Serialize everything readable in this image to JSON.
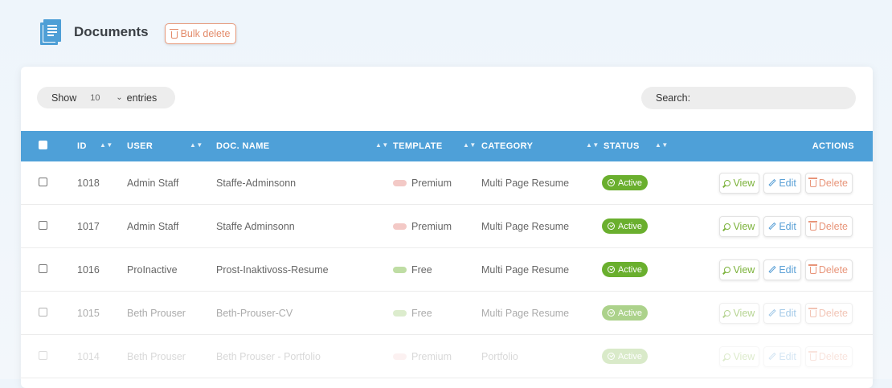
{
  "header": {
    "title": "Documents",
    "bulk_delete_label": "Bulk delete"
  },
  "controls": {
    "show_label": "Show",
    "page_size": "10",
    "entries_label": "entries",
    "search_label": "Search:",
    "search_value": ""
  },
  "table": {
    "columns": [
      "ID",
      "USER",
      "DOC. NAME",
      "TEMPLATE",
      "CATEGORY",
      "STATUS",
      "ACTIONS"
    ],
    "rows": [
      {
        "id": "1018",
        "user": "Admin Staff",
        "doc_name": "Staffe-Adminsonn",
        "template": "Premium",
        "category": "Multi Page Resume",
        "status": "Active"
      },
      {
        "id": "1017",
        "user": "Admin Staff",
        "doc_name": "Staffe Adminsonn",
        "template": "Premium",
        "category": "Multi Page Resume",
        "status": "Active"
      },
      {
        "id": "1016",
        "user": "ProInactive",
        "doc_name": "Prost-Inaktivoss-Resume",
        "template": "Free",
        "category": "Multi Page Resume",
        "status": "Active"
      },
      {
        "id": "1015",
        "user": "Beth Prouser",
        "doc_name": "Beth-Prouser-CV",
        "template": "Free",
        "category": "Multi Page Resume",
        "status": "Active"
      },
      {
        "id": "1014",
        "user": "Beth Prouser",
        "doc_name": "Beth Prouser - Portfolio",
        "template": "Premium",
        "category": "Portfolio",
        "status": "Active"
      }
    ],
    "actions": {
      "view": "View",
      "edit": "Edit",
      "delete": "Delete"
    }
  },
  "colors": {
    "accent": "#4ea0d8",
    "active_badge": "#6aaf2e",
    "premium_pill": "#f3c9c6",
    "free_pill": "#bfdda4",
    "view": "#7bb23a",
    "edit": "#5aa0d6",
    "delete": "#e8957a"
  },
  "icons": {
    "page_icon": "documents-icon",
    "bulk_delete": "trash-icon",
    "view": "magnifier-icon",
    "edit": "pencil-icon",
    "delete": "trash-icon",
    "status": "check-circle-icon"
  }
}
